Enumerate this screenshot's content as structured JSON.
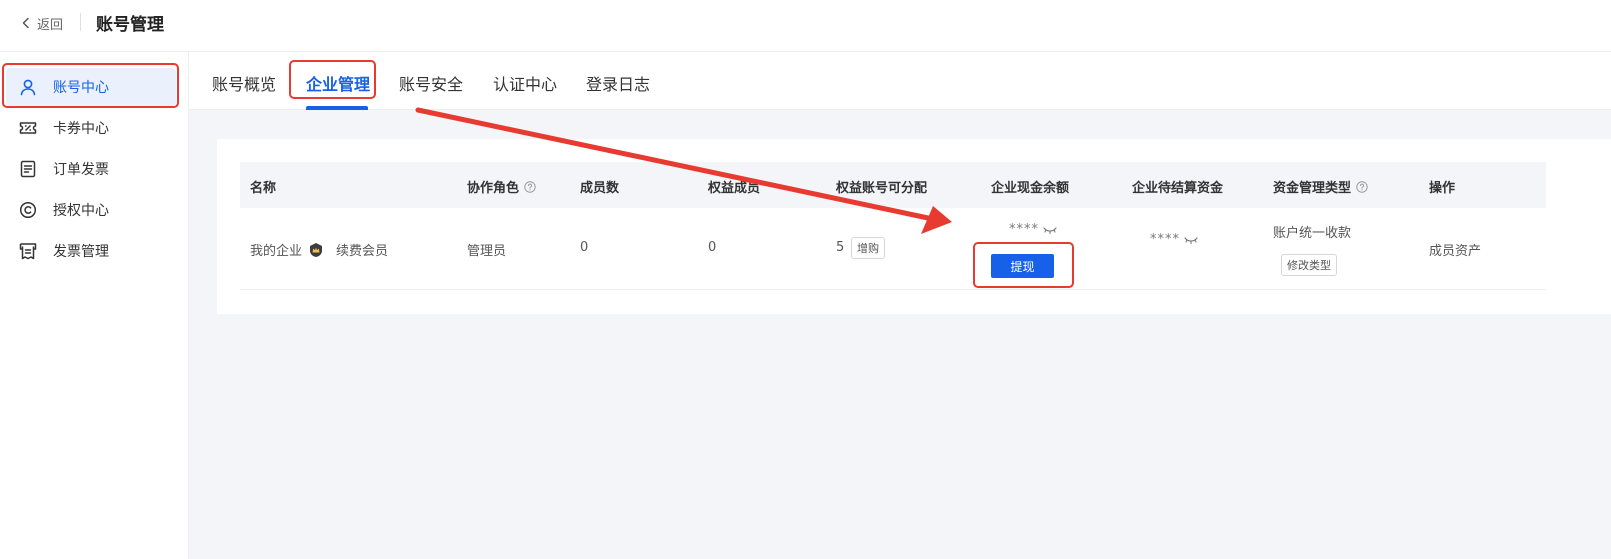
{
  "header": {
    "back_label": "返回",
    "title": "账号管理"
  },
  "sidebar": {
    "items": [
      {
        "label": "账号中心",
        "icon": "user-icon",
        "active": true
      },
      {
        "label": "卡券中心",
        "icon": "coupon-icon",
        "active": false
      },
      {
        "label": "订单发票",
        "icon": "order-icon",
        "active": false
      },
      {
        "label": "授权中心",
        "icon": "copyright-icon",
        "active": false
      },
      {
        "label": "发票管理",
        "icon": "invoice-icon",
        "active": false
      }
    ]
  },
  "tabs": [
    {
      "label": "账号概览",
      "active": false
    },
    {
      "label": "企业管理",
      "active": true
    },
    {
      "label": "账号安全",
      "active": false
    },
    {
      "label": "认证中心",
      "active": false
    },
    {
      "label": "登录日志",
      "active": false
    }
  ],
  "table": {
    "headers": [
      "名称",
      "协作角色",
      "成员数",
      "权益成员",
      "权益账号可分配",
      "企业现金余额",
      "企业待结算资金",
      "资金管理类型",
      "操作"
    ],
    "rows": [
      {
        "name": "我的企业",
        "membership": "续费会员",
        "role": "管理员",
        "members": "0",
        "benefit_members": "0",
        "assignable": "5",
        "buy_more": "增购",
        "cash_balance": "****",
        "withdraw": "提现",
        "pending_funds": "****",
        "fund_type": "账户统一收款",
        "modify_type": "修改类型",
        "action": "成员资产"
      }
    ]
  },
  "colors": {
    "brand": "#1661e8",
    "annotation": "#e83a30"
  }
}
